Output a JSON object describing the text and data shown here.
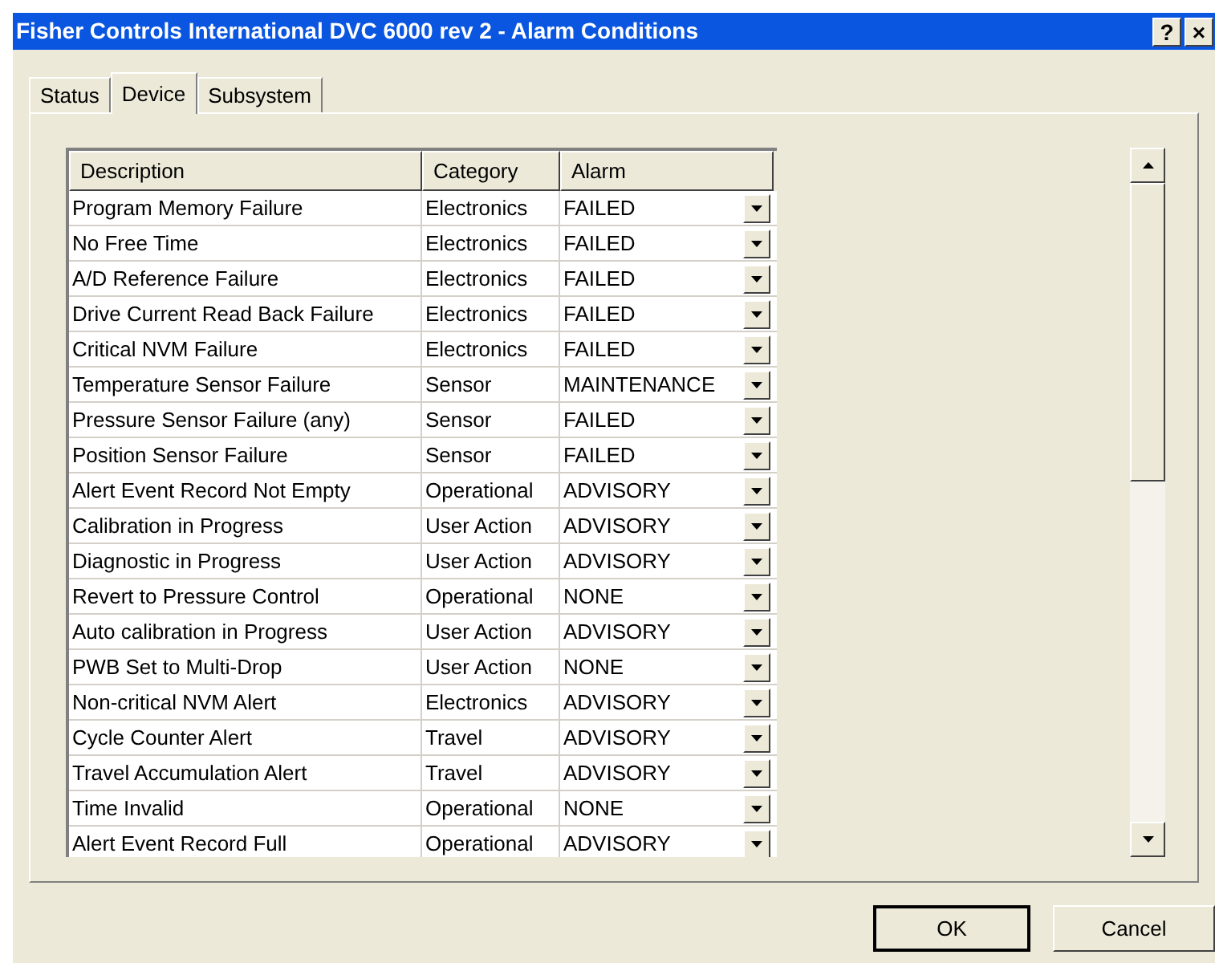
{
  "window": {
    "title": "Fisher Controls International DVC 6000 rev 2 - Alarm Conditions",
    "title_buttons": [
      "?",
      "×"
    ]
  },
  "tabs": [
    {
      "label": "Status",
      "selected": false
    },
    {
      "label": "Device",
      "selected": true
    },
    {
      "label": "Subsystem",
      "selected": false
    }
  ],
  "table": {
    "columns": [
      "Description",
      "Category",
      "Alarm"
    ],
    "rows": [
      {
        "description": "Program Memory Failure",
        "category": "Electronics",
        "alarm": "FAILED"
      },
      {
        "description": "No Free Time",
        "category": "Electronics",
        "alarm": "FAILED"
      },
      {
        "description": "A/D Reference Failure",
        "category": "Electronics",
        "alarm": "FAILED"
      },
      {
        "description": "Drive Current Read Back Failure",
        "category": "Electronics",
        "alarm": "FAILED"
      },
      {
        "description": "Critical NVM Failure",
        "category": "Electronics",
        "alarm": "FAILED"
      },
      {
        "description": "Temperature Sensor Failure",
        "category": "Sensor",
        "alarm": "MAINTENANCE"
      },
      {
        "description": "Pressure Sensor Failure (any)",
        "category": "Sensor",
        "alarm": "FAILED"
      },
      {
        "description": "Position Sensor Failure",
        "category": "Sensor",
        "alarm": "FAILED"
      },
      {
        "description": "Alert Event Record Not Empty",
        "category": "Operational",
        "alarm": "ADVISORY"
      },
      {
        "description": "Calibration in Progress",
        "category": "User Action",
        "alarm": "ADVISORY"
      },
      {
        "description": "Diagnostic in Progress",
        "category": "User Action",
        "alarm": "ADVISORY"
      },
      {
        "description": "Revert to Pressure Control",
        "category": "Operational",
        "alarm": "NONE"
      },
      {
        "description": "Auto calibration in Progress",
        "category": "User Action",
        "alarm": "ADVISORY"
      },
      {
        "description": "PWB Set to Multi-Drop",
        "category": "User Action",
        "alarm": "NONE"
      },
      {
        "description": "Non-critical NVM Alert",
        "category": "Electronics",
        "alarm": "ADVISORY"
      },
      {
        "description": "Cycle Counter Alert",
        "category": "Travel",
        "alarm": "ADVISORY"
      },
      {
        "description": "Travel Accumulation Alert",
        "category": "Travel",
        "alarm": "ADVISORY"
      },
      {
        "description": "Time Invalid",
        "category": "Operational",
        "alarm": "NONE"
      },
      {
        "description": "Alert Event Record Full",
        "category": "Operational",
        "alarm": "ADVISORY"
      }
    ]
  },
  "buttons": [
    {
      "label": "OK",
      "kind": "default"
    },
    {
      "label": "Cancel",
      "kind": "normal"
    }
  ]
}
